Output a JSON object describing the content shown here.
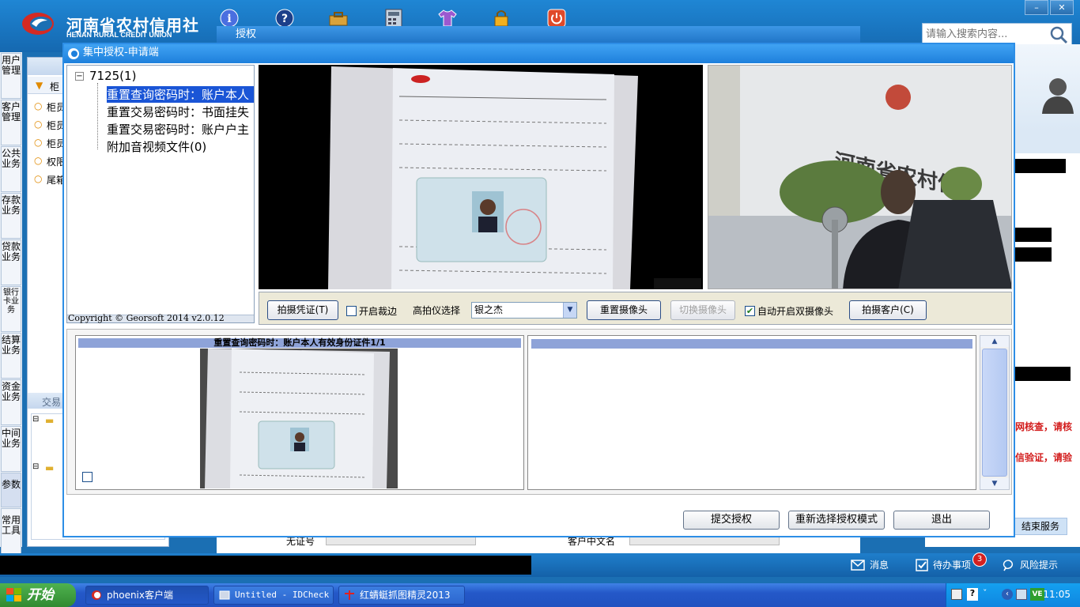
{
  "app": {
    "logo_cn": "河南省农村信用社",
    "logo_en": "HENAN RURAL CREDIT UNION",
    "search_placeholder": "请输入搜索内容...",
    "auth_window_title": "授权",
    "window_controls": {
      "minimize": "–",
      "close": "✕"
    }
  },
  "left_rail": {
    "tabs": [
      "用户管理",
      "客户管理",
      "公共业务",
      "存款业务",
      "贷款业务",
      "银行卡业务",
      "结算业务",
      "资金业务",
      "中间业务",
      "参数",
      "常用工具"
    ]
  },
  "left_panel": {
    "header_partial": "月",
    "group_partial": "柜",
    "items": [
      "柜员",
      "柜员",
      "柜员",
      "权限",
      "尾箱"
    ],
    "lower_header_partial": "交易"
  },
  "right_panel": {
    "red_links": [
      "网核查，请核",
      "信验证，请验"
    ],
    "end_service": "结束服务"
  },
  "status_bar": {
    "messages": "消息",
    "todo": "待办事项",
    "todo_count": "3",
    "risk": "风险提示"
  },
  "behind_form": {
    "cert_label_partial": "无证号",
    "name_label_partial": "客户中文名"
  },
  "taskbar": {
    "start": "开始",
    "tasks": [
      "phoenix客户端",
      "Untitled - IDCheck",
      "红蜻蜓抓图精灵2013"
    ],
    "clock": "11:05"
  },
  "dialog": {
    "title": "集中授权-申请端",
    "tree": {
      "root": "7125(1)",
      "children": [
        "重置查询密码时：账户本人",
        "重置交易密码时：书面挂失",
        "重置交易密码时：账户户主",
        "附加音视频文件(0)"
      ]
    },
    "copyright": "Copyright © Georsoft 2014 v2.0.12",
    "toolbar": {
      "capture_voucher": "拍摄凭证(T)",
      "enable_crop": "开启裁边",
      "enable_crop_checked": false,
      "device_label": "高拍仪选择",
      "device_value": "银之杰",
      "reset_camera": "重置摄像头",
      "switch_camera": "切换摄像头",
      "auto_dual": "自动开启双摄像头",
      "auto_dual_checked": true,
      "capture_customer": "拍摄客户(C)"
    },
    "preview": {
      "left_caption": "重置查询密码时：账户本人有效身份证件1/1"
    },
    "buttons": {
      "submit": "提交授权",
      "reselect": "重新选择授权模式",
      "exit": "退出"
    }
  },
  "colors": {
    "app_blue": "#1b6fb3",
    "dialog_title": "#1e80dc",
    "selection": "#1a55d6",
    "alert_red": "#d21b1b"
  }
}
